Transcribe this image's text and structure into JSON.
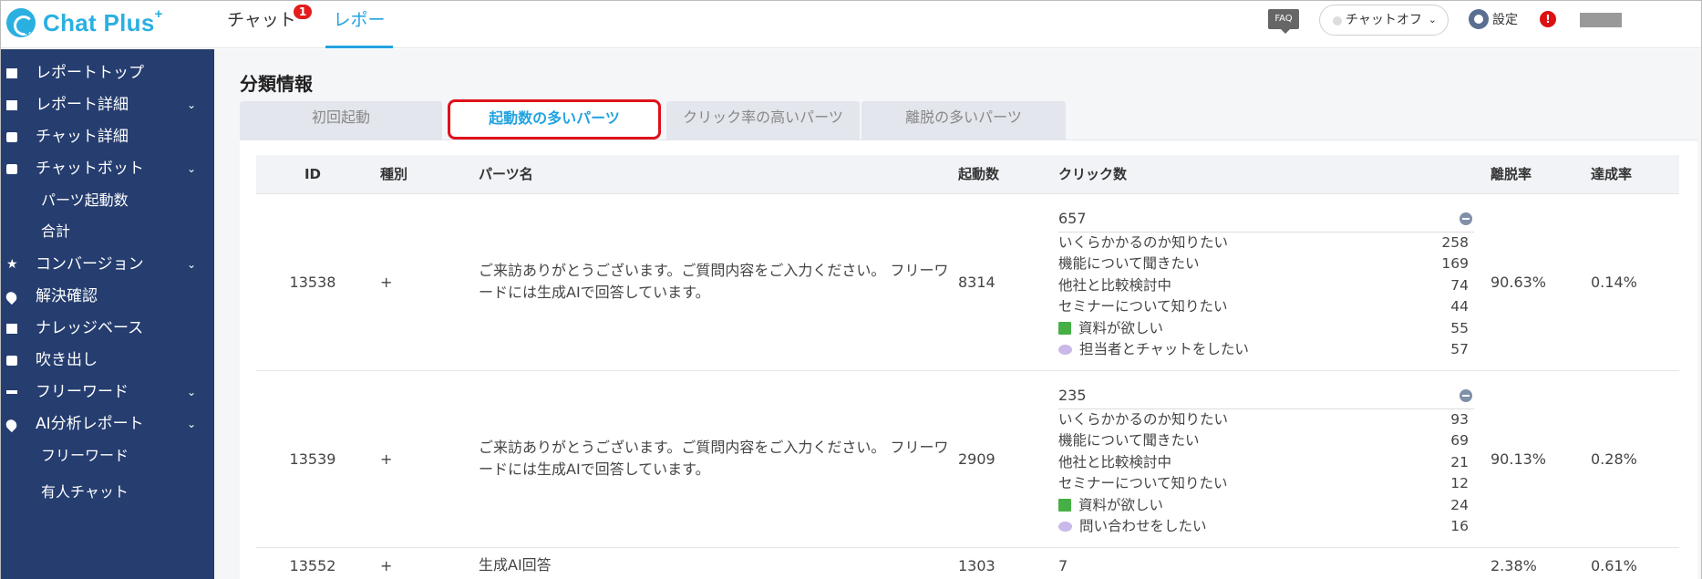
{
  "header": {
    "logo": "Chat Plus",
    "logo_sup": "+",
    "nav_chat": "チャット",
    "nav_chat_badge": "1",
    "nav_report": "レポート",
    "faq": "FAQ",
    "chat_status": "チャットオフ",
    "settings": "設定",
    "alert": "!"
  },
  "sidebar": {
    "items": [
      {
        "label": "レポートトップ"
      },
      {
        "label": "レポート詳細"
      },
      {
        "label": "チャット詳細"
      },
      {
        "label": "チャットボット"
      },
      {
        "label": "パーツ起動数"
      },
      {
        "label": "合計"
      },
      {
        "label": "コンバージョン"
      },
      {
        "label": "解決確認"
      },
      {
        "label": "ナレッジベース"
      },
      {
        "label": "吹き出し"
      },
      {
        "label": "フリーワード"
      },
      {
        "label": "AI分析レポート"
      },
      {
        "label": "フリーワード"
      },
      {
        "label": "有人チャット"
      }
    ]
  },
  "main": {
    "title": "分類情報",
    "tabs": [
      {
        "label": "初回起動"
      },
      {
        "label": "起動数の多いパーツ"
      },
      {
        "label": "クリック率の高いパーツ"
      },
      {
        "label": "離脱の多いパーツ"
      }
    ],
    "table": {
      "headers": [
        "ID",
        "種別",
        "パーツ名",
        "起動数",
        "クリック数",
        "離脱率",
        "達成率"
      ],
      "rows": [
        {
          "id": "13538",
          "type": "+",
          "name": "ご来訪ありがとうございます。ご質問内容をご入力ください。 フリーワードには生成AIで回答しています。",
          "launch": "8314",
          "click_total": "657",
          "clicks": [
            {
              "label": "いくらかかるのか知りたい",
              "value": "258"
            },
            {
              "label": "機能について聞きたい",
              "value": "169"
            },
            {
              "label": "他社と比較検討中",
              "value": "74"
            },
            {
              "label": "セミナーについて知りたい",
              "value": "44"
            },
            {
              "label": "資料が欲しい",
              "value": "55"
            },
            {
              "label": "担当者とチャットをしたい",
              "value": "57"
            }
          ],
          "bounce": "90.63%",
          "achieve": "0.14%"
        },
        {
          "id": "13539",
          "type": "+",
          "name": "ご来訪ありがとうございます。ご質問内容をご入力ください。 フリーワードには生成AIで回答しています。",
          "launch": "2909",
          "click_total": "235",
          "clicks": [
            {
              "label": "いくらかかるのか知りたい",
              "value": "93"
            },
            {
              "label": "機能について聞きたい",
              "value": "69"
            },
            {
              "label": "他社と比較検討中",
              "value": "21"
            },
            {
              "label": "セミナーについて知りたい",
              "value": "12"
            },
            {
              "label": "資料が欲しい",
              "value": "24"
            },
            {
              "label": "問い合わせをしたい",
              "value": "16"
            }
          ],
          "bounce": "90.13%",
          "achieve": "0.28%"
        },
        {
          "id": "13552",
          "type": "+",
          "name": "生成AI回答",
          "launch": "1303",
          "click_total": "7",
          "bounce": "2.38%",
          "achieve": "0.61%"
        }
      ]
    }
  }
}
